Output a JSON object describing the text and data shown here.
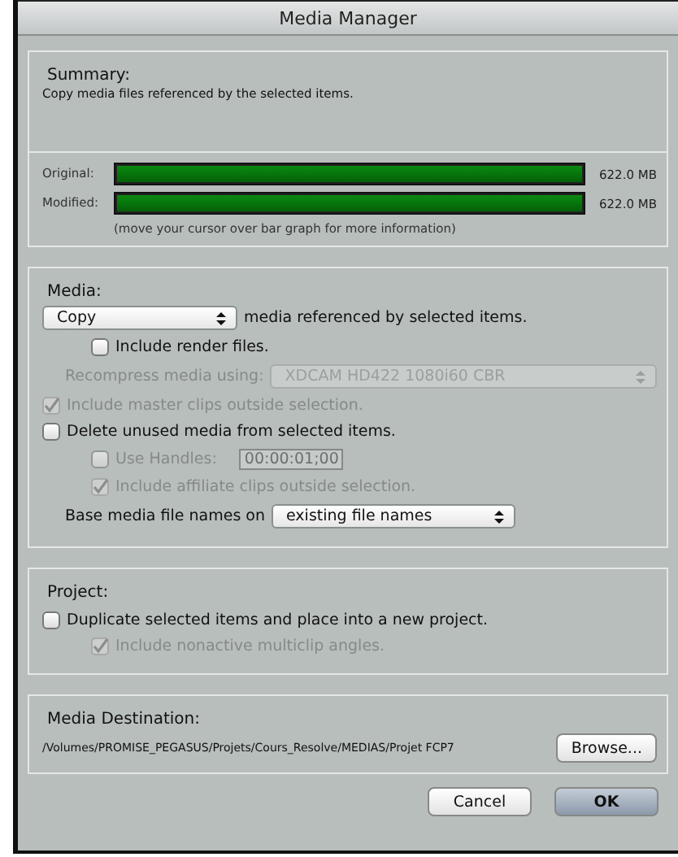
{
  "window": {
    "title": "Media Manager"
  },
  "summary": {
    "title": "Summary:",
    "description": "Copy media files referenced by the selected items.",
    "bars": [
      {
        "label": "Original:",
        "level": 1,
        "reading": "622.0 MB"
      },
      {
        "label": "Modified:",
        "level": 1,
        "reading": "622.0 MB"
      }
    ],
    "hint": "(move your cursor over bar graph for more information)"
  },
  "media": {
    "title": "Media:",
    "operation": "Copy",
    "operation_text": "media referenced by selected items.",
    "rows": [
      {
        "kind": "subcheck",
        "label": "Include render files.",
        "checked": false,
        "disabled": false
      },
      {
        "kind": "select",
        "label": "Recompress media using:",
        "value": "XDCAM HD422 1080i60 CBR",
        "disabled": true
      },
      {
        "kind": "check",
        "label": "Include master clips outside selection.",
        "checked": true,
        "disabled": true
      },
      {
        "kind": "check",
        "label": "Delete unused media from selected items.",
        "checked": false,
        "disabled": false,
        "children": [
          {
            "kind": "timecode",
            "label": "Use Handles:",
            "value": "00:00:01;00",
            "checked": false,
            "disabled": true
          },
          {
            "kind": "check",
            "label": "Include affiliate clips outside selection.",
            "checked": true,
            "disabled": true
          }
        ]
      },
      {
        "kind": "select",
        "label": "Base media file names on",
        "value": "existing file names",
        "disabled": false
      }
    ]
  },
  "project": {
    "title": "Project:",
    "rows": [
      {
        "kind": "check",
        "label": "Duplicate selected items and place into a new project.",
        "checked": false,
        "disabled": false,
        "children": [
          {
            "kind": "check",
            "label": "Include nonactive multiclip angles.",
            "checked": true,
            "disabled": true
          }
        ]
      }
    ]
  },
  "destination": {
    "title": "Media Destination:",
    "path": "/Volumes/PROMISE_PEGASUS/Projets/Cours_Resolve/MEDIAS/Projet FCP7",
    "browse": "Browse..."
  },
  "buttons": [
    {
      "label": "Cancel",
      "default": false
    },
    {
      "label": "OK",
      "default": true
    }
  ]
}
